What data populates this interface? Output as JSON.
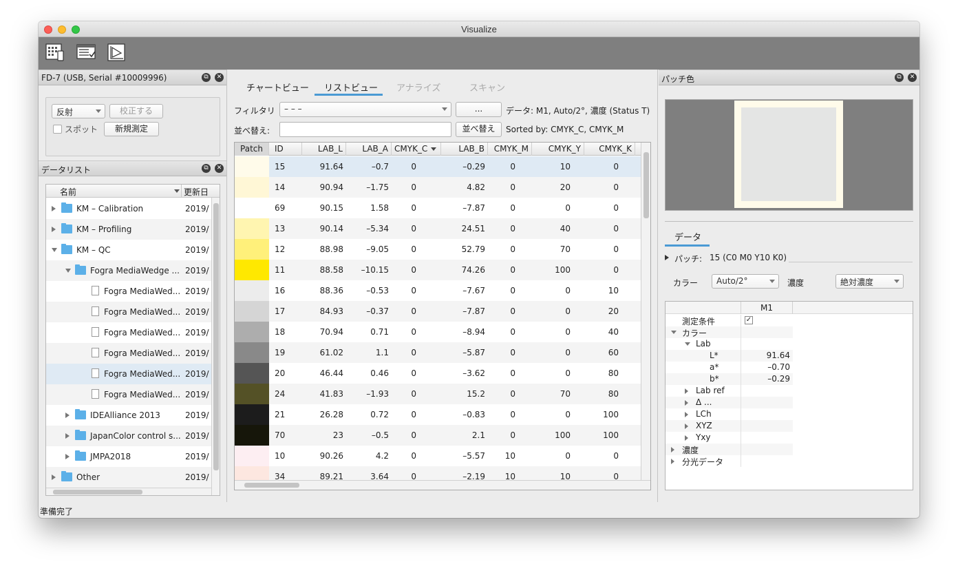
{
  "window": {
    "title": "Visualize"
  },
  "toolbar": {
    "icons": [
      "chart-view-icon",
      "list-view-icon",
      "analyze-view-icon"
    ]
  },
  "device_panel": {
    "title": "FD-7 (USB, Serial #10009996)",
    "mode_select": "反射",
    "calibrate_button": "校正する",
    "spot_label": "スポット",
    "new_measure_button": "新規測定"
  },
  "datalist": {
    "title": "データリスト",
    "col_name": "名前",
    "col_date": "更新日",
    "rows": [
      {
        "label": "KM – Calibration",
        "date": "2019/",
        "type": "folder",
        "level": 0,
        "state": "closed"
      },
      {
        "label": "KM – Profiling",
        "date": "2019/",
        "type": "folder",
        "level": 0,
        "state": "closed"
      },
      {
        "label": "KM – QC",
        "date": "2019/",
        "type": "folder",
        "level": 0,
        "state": "open"
      },
      {
        "label": "Fogra MediaWedge ...",
        "date": "2019/",
        "type": "folder",
        "level": 1,
        "state": "open"
      },
      {
        "label": "Fogra MediaWed...",
        "date": "2019/",
        "type": "doc",
        "level": 2,
        "state": ""
      },
      {
        "label": "Fogra MediaWed...",
        "date": "2019/",
        "type": "doc",
        "level": 2,
        "state": ""
      },
      {
        "label": "Fogra MediaWed...",
        "date": "2019/",
        "type": "doc",
        "level": 2,
        "state": ""
      },
      {
        "label": "Fogra MediaWed...",
        "date": "2019/",
        "type": "doc",
        "level": 2,
        "state": ""
      },
      {
        "label": "Fogra MediaWed...",
        "date": "2019/",
        "type": "doc",
        "level": 2,
        "state": "",
        "selected": true
      },
      {
        "label": "Fogra MediaWed...",
        "date": "2019/",
        "type": "doc",
        "level": 2,
        "state": ""
      },
      {
        "label": "IDEAlliance 2013",
        "date": "2019/",
        "type": "folder",
        "level": 1,
        "state": "closed"
      },
      {
        "label": "JapanColor control s...",
        "date": "2019/",
        "type": "folder",
        "level": 1,
        "state": "closed"
      },
      {
        "label": "JMPA2018",
        "date": "2019/",
        "type": "folder",
        "level": 1,
        "state": "closed"
      },
      {
        "label": "Other",
        "date": "2019/",
        "type": "folder",
        "level": 0,
        "state": "closed"
      }
    ]
  },
  "tabs": [
    {
      "label": "チャートビュー",
      "active": false,
      "dim": false
    },
    {
      "label": "リストビュー",
      "active": true,
      "dim": false
    },
    {
      "label": "アナライズ",
      "active": false,
      "dim": true
    },
    {
      "label": "スキャン",
      "active": false,
      "dim": true
    }
  ],
  "filter": {
    "label": "フィルタリ",
    "value": "– – –",
    "more_button": "...",
    "data_info": "データ: M1, Auto/2°, 濃度 (Status T)"
  },
  "sort": {
    "label": "並べ替え:",
    "value": "",
    "button": "並べ替え",
    "info": "Sorted by: CMYK_C, CMYK_M"
  },
  "table": {
    "columns": [
      "Patch",
      "ID",
      "LAB_L",
      "LAB_A",
      "CMYK_C",
      "LAB_B",
      "CMYK_M",
      "CMYK_Y",
      "CMYK_K"
    ],
    "rows": [
      {
        "color": "#fffbea",
        "id": "15",
        "L": "91.64",
        "A": "–0.7",
        "C": "0",
        "B": "–0.29",
        "M": "0",
        "Y": "10",
        "K": "0"
      },
      {
        "color": "#fff7d6",
        "id": "14",
        "L": "90.94",
        "A": "–1.75",
        "C": "0",
        "B": "4.82",
        "M": "0",
        "Y": "20",
        "K": "0"
      },
      {
        "color": "#ffffff",
        "id": "69",
        "L": "90.15",
        "A": "1.58",
        "C": "0",
        "B": "–7.87",
        "M": "0",
        "Y": "0",
        "K": "0"
      },
      {
        "color": "#fff5b0",
        "id": "13",
        "L": "90.14",
        "A": "–5.34",
        "C": "0",
        "B": "24.51",
        "M": "0",
        "Y": "40",
        "K": "0"
      },
      {
        "color": "#fff07a",
        "id": "12",
        "L": "88.98",
        "A": "–9.05",
        "C": "0",
        "B": "52.79",
        "M": "0",
        "Y": "70",
        "K": "0"
      },
      {
        "color": "#ffe800",
        "id": "11",
        "L": "88.58",
        "A": "–10.15",
        "C": "0",
        "B": "74.26",
        "M": "0",
        "Y": "100",
        "K": "0"
      },
      {
        "color": "#ececec",
        "id": "16",
        "L": "88.36",
        "A": "–0.53",
        "C": "0",
        "B": "–7.67",
        "M": "0",
        "Y": "0",
        "K": "10"
      },
      {
        "color": "#d5d5d5",
        "id": "17",
        "L": "84.93",
        "A": "–0.37",
        "C": "0",
        "B": "–7.87",
        "M": "0",
        "Y": "0",
        "K": "20"
      },
      {
        "color": "#adadad",
        "id": "18",
        "L": "70.94",
        "A": "0.71",
        "C": "0",
        "B": "–8.94",
        "M": "0",
        "Y": "0",
        "K": "40"
      },
      {
        "color": "#898989",
        "id": "19",
        "L": "61.02",
        "A": "1.1",
        "C": "0",
        "B": "–5.87",
        "M": "0",
        "Y": "0",
        "K": "60"
      },
      {
        "color": "#555555",
        "id": "20",
        "L": "46.44",
        "A": "0.46",
        "C": "0",
        "B": "–3.62",
        "M": "0",
        "Y": "0",
        "K": "80"
      },
      {
        "color": "#545126",
        "id": "24",
        "L": "41.83",
        "A": "–1.93",
        "C": "0",
        "B": "15.2",
        "M": "0",
        "Y": "70",
        "K": "80"
      },
      {
        "color": "#1c1c1c",
        "id": "21",
        "L": "26.28",
        "A": "0.72",
        "C": "0",
        "B": "–0.83",
        "M": "0",
        "Y": "0",
        "K": "100"
      },
      {
        "color": "#16160a",
        "id": "70",
        "L": "23",
        "A": "–0.5",
        "C": "0",
        "B": "2.1",
        "M": "0",
        "Y": "100",
        "K": "100"
      },
      {
        "color": "#fdeef2",
        "id": "10",
        "L": "90.26",
        "A": "4.2",
        "C": "0",
        "B": "–5.57",
        "M": "10",
        "Y": "0",
        "K": "0"
      },
      {
        "color": "#fde7e0",
        "id": "34",
        "L": "89.21",
        "A": "3.64",
        "C": "0",
        "B": "–2.19",
        "M": "10",
        "Y": "10",
        "K": "0"
      }
    ]
  },
  "patch_panel": {
    "title": "パッチ色",
    "data_tab": "データ",
    "patch_label": "パッチ:",
    "patch_value": "15 (C0 M0 Y10 K0)",
    "color_label": "カラー",
    "color_select": "Auto/2°",
    "density_label": "濃度",
    "density_select": "絶対濃度",
    "col_m1": "M1",
    "props": [
      {
        "k": "測定条件",
        "v": "",
        "level": 0,
        "disc": "",
        "check": true
      },
      {
        "k": "カラー",
        "v": "",
        "level": 0,
        "disc": "open"
      },
      {
        "k": "Lab",
        "v": "",
        "level": 1,
        "disc": "open"
      },
      {
        "k": "L*",
        "v": "91.64",
        "level": 2,
        "disc": ""
      },
      {
        "k": "a*",
        "v": "–0.70",
        "level": 2,
        "disc": ""
      },
      {
        "k": "b*",
        "v": "–0.29",
        "level": 2,
        "disc": ""
      },
      {
        "k": "Lab ref",
        "v": "",
        "level": 1,
        "disc": "closed"
      },
      {
        "k": "Δ ...",
        "v": "",
        "level": 1,
        "disc": "closed"
      },
      {
        "k": "LCh",
        "v": "",
        "level": 1,
        "disc": "closed"
      },
      {
        "k": "XYZ",
        "v": "",
        "level": 1,
        "disc": "closed"
      },
      {
        "k": "Yxy",
        "v": "",
        "level": 1,
        "disc": "closed"
      },
      {
        "k": "濃度",
        "v": "",
        "level": 0,
        "disc": "closed"
      },
      {
        "k": "分光データ",
        "v": "",
        "level": 0,
        "disc": "closed"
      }
    ]
  },
  "status": "準備完了",
  "colors": {
    "accent": "#4a9ad4",
    "selection": "#dfeaf4",
    "folder": "#5cb0e8",
    "toolbar": "#7f7f7f"
  }
}
